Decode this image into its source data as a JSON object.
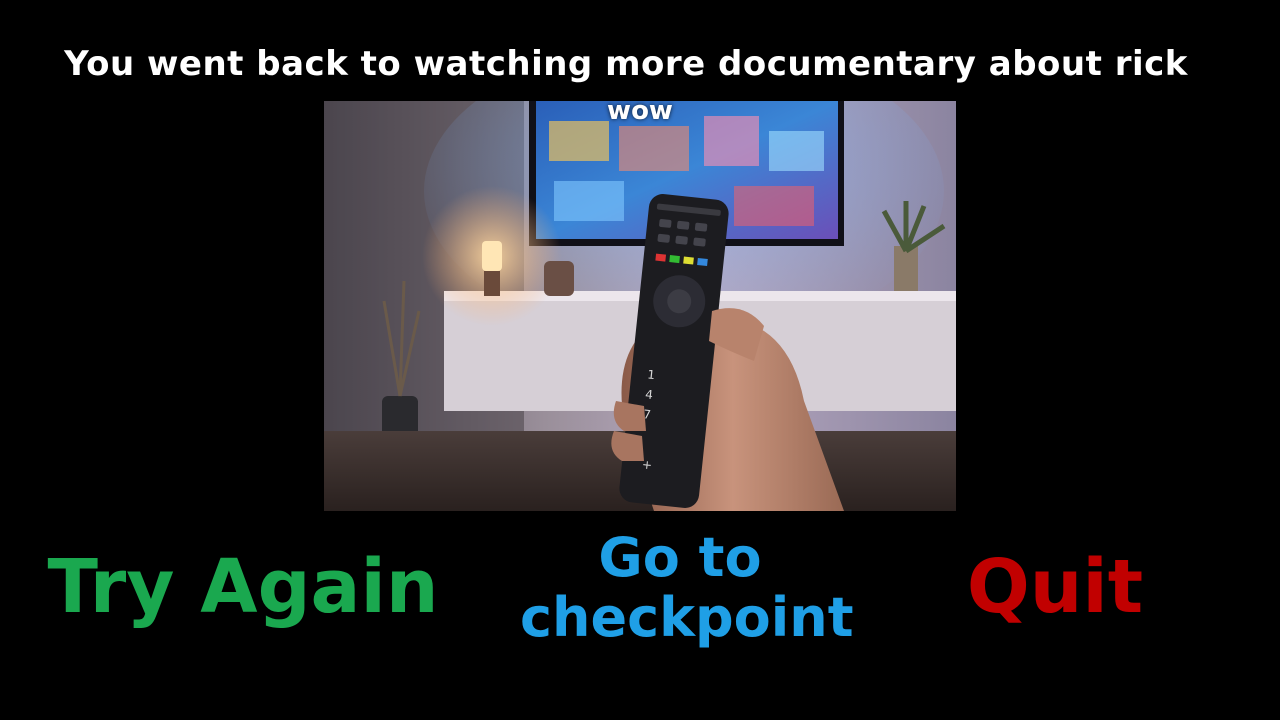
{
  "scene": {
    "message": "You went back to watching more documentary about rick",
    "subtitle": "wow"
  },
  "buttons": {
    "try_again": "Try Again",
    "checkpoint": "Go to checkpoint",
    "quit": "Quit"
  },
  "colors": {
    "background": "#000000",
    "message": "#ffffff",
    "try_again": "#1aa84f",
    "checkpoint": "#1f9fe6",
    "quit": "#c10000"
  }
}
